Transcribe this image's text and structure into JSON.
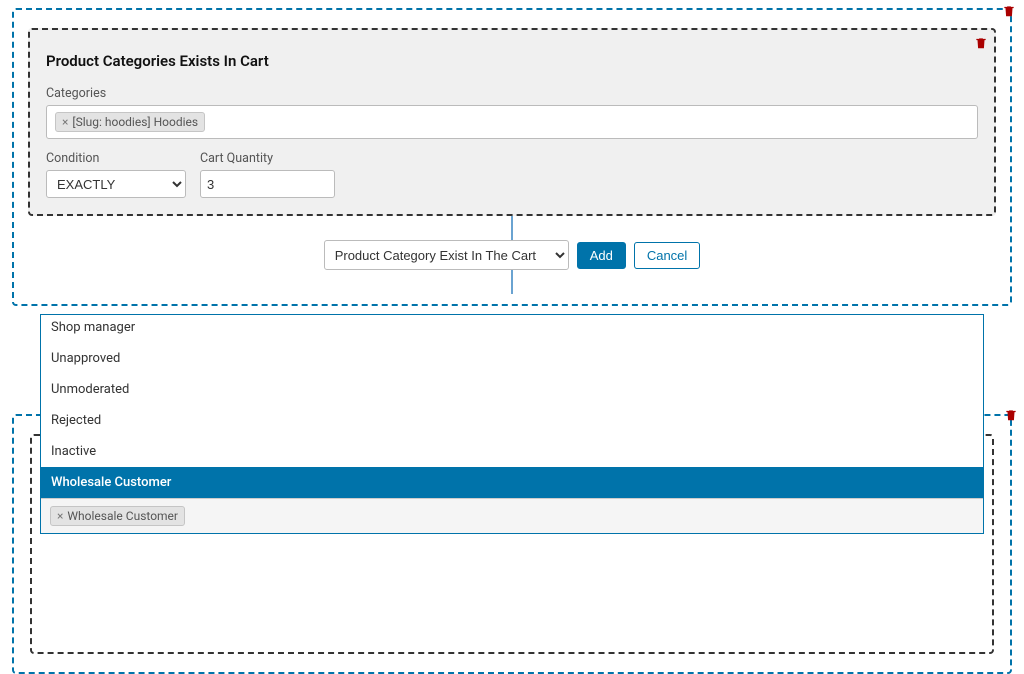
{
  "group1": {
    "block": {
      "title": "Product Categories Exists In Cart",
      "categories_label": "Categories",
      "categories_tags": [
        "[Slug: hoodies] Hoodies"
      ],
      "condition_label": "Condition",
      "condition_value": "EXACTLY",
      "qty_label": "Cart Quantity",
      "qty_value": "3"
    },
    "add": {
      "type_value": "Product Category Exist In The Cart",
      "add_label": "Add",
      "cancel_label": "Cancel"
    }
  },
  "group2": {
    "dropdown": {
      "options": [
        {
          "label": "Shop manager",
          "selected": false
        },
        {
          "label": "Unapproved",
          "selected": false
        },
        {
          "label": "Unmoderated",
          "selected": false
        },
        {
          "label": "Rejected",
          "selected": false
        },
        {
          "label": "Inactive",
          "selected": false
        },
        {
          "label": "Wholesale Customer",
          "selected": true
        }
      ],
      "selected_tag": "Wholesale Customer"
    }
  }
}
